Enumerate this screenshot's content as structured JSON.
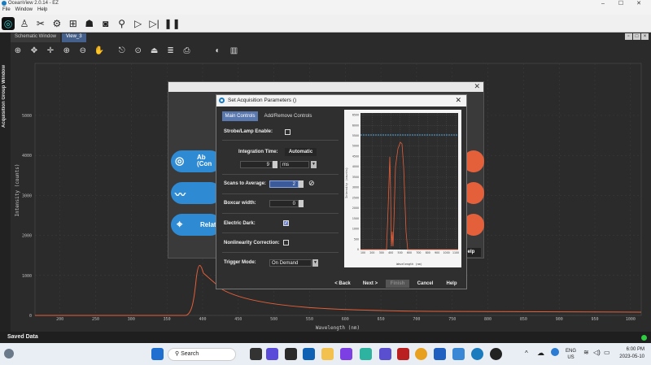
{
  "app": {
    "title": "OceanView 2.0.14 - EZ",
    "window_controls": [
      "–",
      "☐",
      "✕"
    ]
  },
  "menu": [
    "File",
    "Window",
    "Help"
  ],
  "sidebar": {
    "label": "Acquisition Group Window"
  },
  "tabs": [
    {
      "label": "Schematic Window"
    },
    {
      "label": "View_3"
    }
  ],
  "plot": {
    "ylabel": "Intensity (counts)",
    "xlabel": "Wavelength (nm)",
    "yticks": [
      "5000",
      "4000",
      "3000",
      "2000",
      "1000",
      "0"
    ],
    "xticks": [
      "200",
      "250",
      "300",
      "350",
      "400",
      "450",
      "500",
      "550",
      "600",
      "650",
      "700",
      "750",
      "800",
      "850",
      "900",
      "950",
      "1000"
    ]
  },
  "background_dialog": {
    "pill1": "Ab (Con",
    "pill3": "Relati",
    "help": "elp",
    "pill_color": "#2e8bd3",
    "orange_color": "#e4603a"
  },
  "dialog": {
    "title": "Set Acquisition Parameters ()",
    "tab_main": "Main Controls",
    "tab_add": "Add/Remove Controls",
    "strobe_label": "Strobe/Lamp Enable:",
    "integration_label": "Integration Time:",
    "automatic": "Automatic",
    "integration_value": "9",
    "integration_unit": "ms",
    "scans_label": "Scans to Average:",
    "scans_value": "2",
    "boxcar_label": "Boxcar width:",
    "boxcar_value": "0",
    "dark_label": "Electric Dark:",
    "nonlin_label": "Nonlinearity Correction:",
    "trigger_label": "Trigger Mode:",
    "trigger_value": "On Demand",
    "back": "< Back",
    "next": "Next >",
    "finish": "Finish",
    "cancel": "Cancel",
    "help": "Help",
    "accent": "#5a78b0"
  },
  "preview": {
    "ylabel": "Intensity (counts)",
    "xlabel": "Wavelength (nm)",
    "yticks": [
      "6500",
      "6000",
      "5500",
      "5000",
      "4500",
      "4000",
      "3500",
      "3000",
      "2500",
      "2000",
      "1500",
      "1000",
      "500",
      "0"
    ],
    "xticks": [
      "100",
      "200",
      "300",
      "400",
      "500",
      "600",
      "700",
      "800",
      "900",
      "1000",
      "1100"
    ]
  },
  "saved": {
    "label": "Saved Data"
  },
  "taskbar": {
    "search": "Search",
    "lang1": "ENG",
    "lang2": "US",
    "time": "6:00 PM",
    "date": "2023-05-10"
  }
}
